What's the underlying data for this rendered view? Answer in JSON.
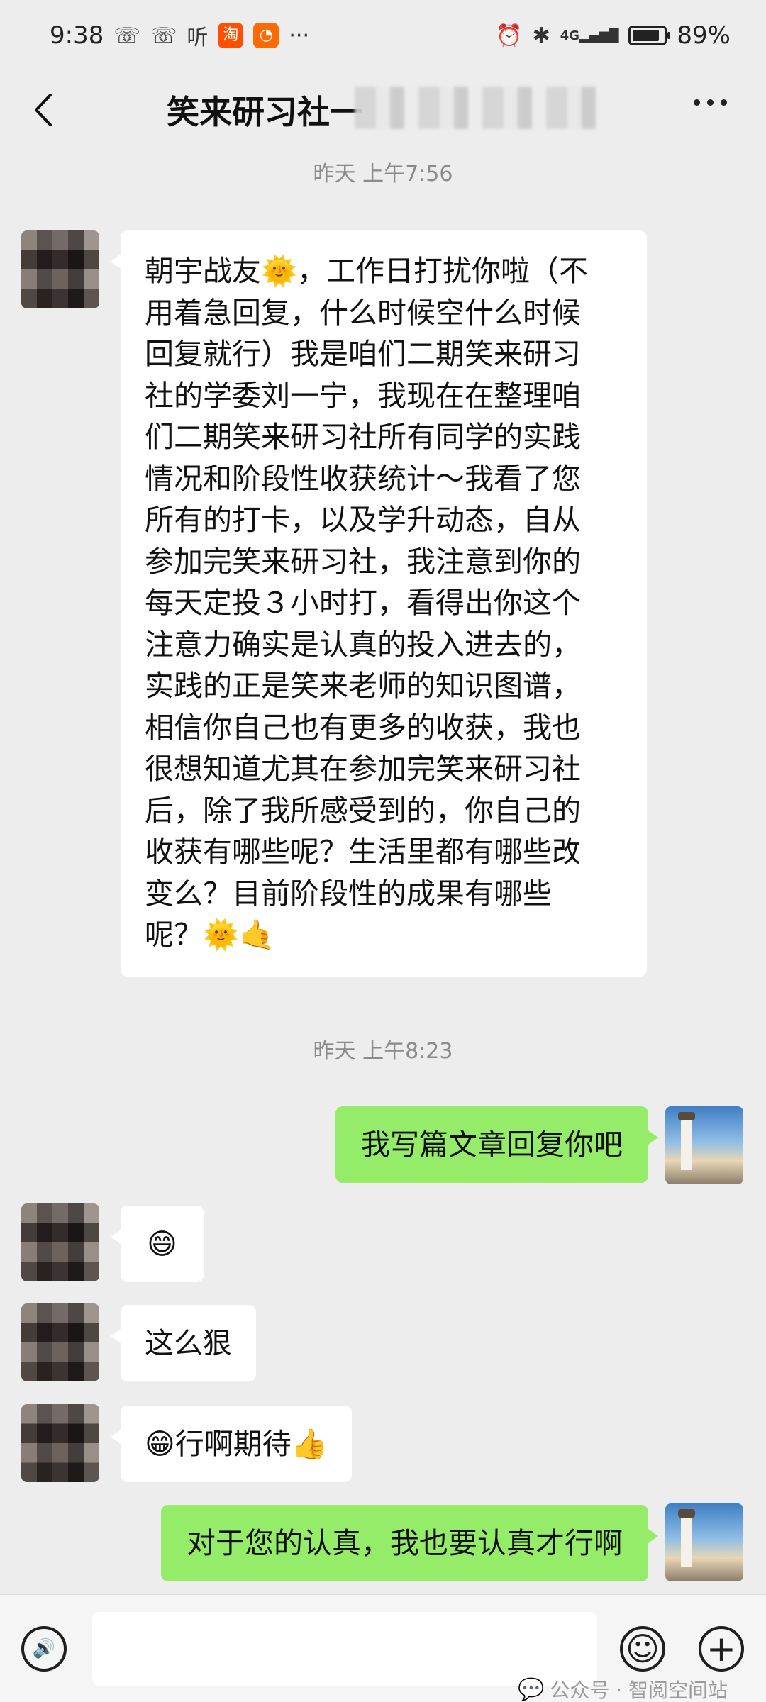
{
  "status_bar": {
    "time": "9:38",
    "icons_left": [
      "missed-call-icon",
      "missed-call-icon",
      "listen-app-icon",
      "taobao-app-icon",
      "alibaba-app-icon",
      "more-notifications-icon"
    ],
    "listen_label": "听",
    "taobao_label": "淘",
    "more_label": "···",
    "icons_right": [
      "alarm-icon",
      "bluetooth-icon",
      "4g-signal-icon",
      "battery-icon"
    ],
    "network_label": "4G",
    "battery_percent": "89%",
    "battery_level": 0.89
  },
  "header": {
    "title": "笑来研习社一",
    "back_icon": "chevron-left-icon",
    "more_icon": "more-dots-icon"
  },
  "messages": [
    {
      "type": "timestamp",
      "text": "昨天 上午7:56"
    },
    {
      "type": "incoming",
      "lines": [
        "朝宇战友🌞，工作日打扰你啦（不",
        "用着急回复，什么时候空什么时候",
        "回复就行）我是咱们二期笑来研习",
        "社的学委刘一宁，我现在在整理咱",
        "们二期笑来研习社所有同学的实践",
        "情况和阶段性收获统计～我看了您",
        "所有的打卡，以及学升动态，自从",
        "参加完笑来研习社，我注意到你的",
        "每天定投３小时打，看得出你这个",
        "注意力确实是认真的投入进去的，",
        "实践的正是笑来老师的知识图谱，",
        "相信你自己也有更多的收获，我也",
        "很想知道尤其在参加完笑来研习社",
        "后，除了我所感受到的，你自己的",
        "收获有哪些呢？生活里都有哪些改",
        "变么？目前阶段性的成果有哪些",
        "呢？🌞🤙"
      ]
    },
    {
      "type": "timestamp",
      "text": "昨天 上午8:23"
    },
    {
      "type": "outgoing",
      "text": "我写篇文章回复你吧"
    },
    {
      "type": "incoming",
      "text": "😄"
    },
    {
      "type": "incoming",
      "text": "这么狠"
    },
    {
      "type": "incoming",
      "text": "😁行啊期待👍"
    },
    {
      "type": "outgoing",
      "text": "对于您的认真，我也要认真才行啊"
    }
  ],
  "input_bar": {
    "voice_icon": "voice-icon",
    "emoji_icon": "emoji-icon",
    "plus_icon": "plus-icon",
    "voice_glyph": "🔊",
    "emoji_glyph": "☺",
    "plus_glyph": "+"
  },
  "watermark": {
    "text": "公众号 · 智阅空间站",
    "icon": "wechat-icon"
  }
}
